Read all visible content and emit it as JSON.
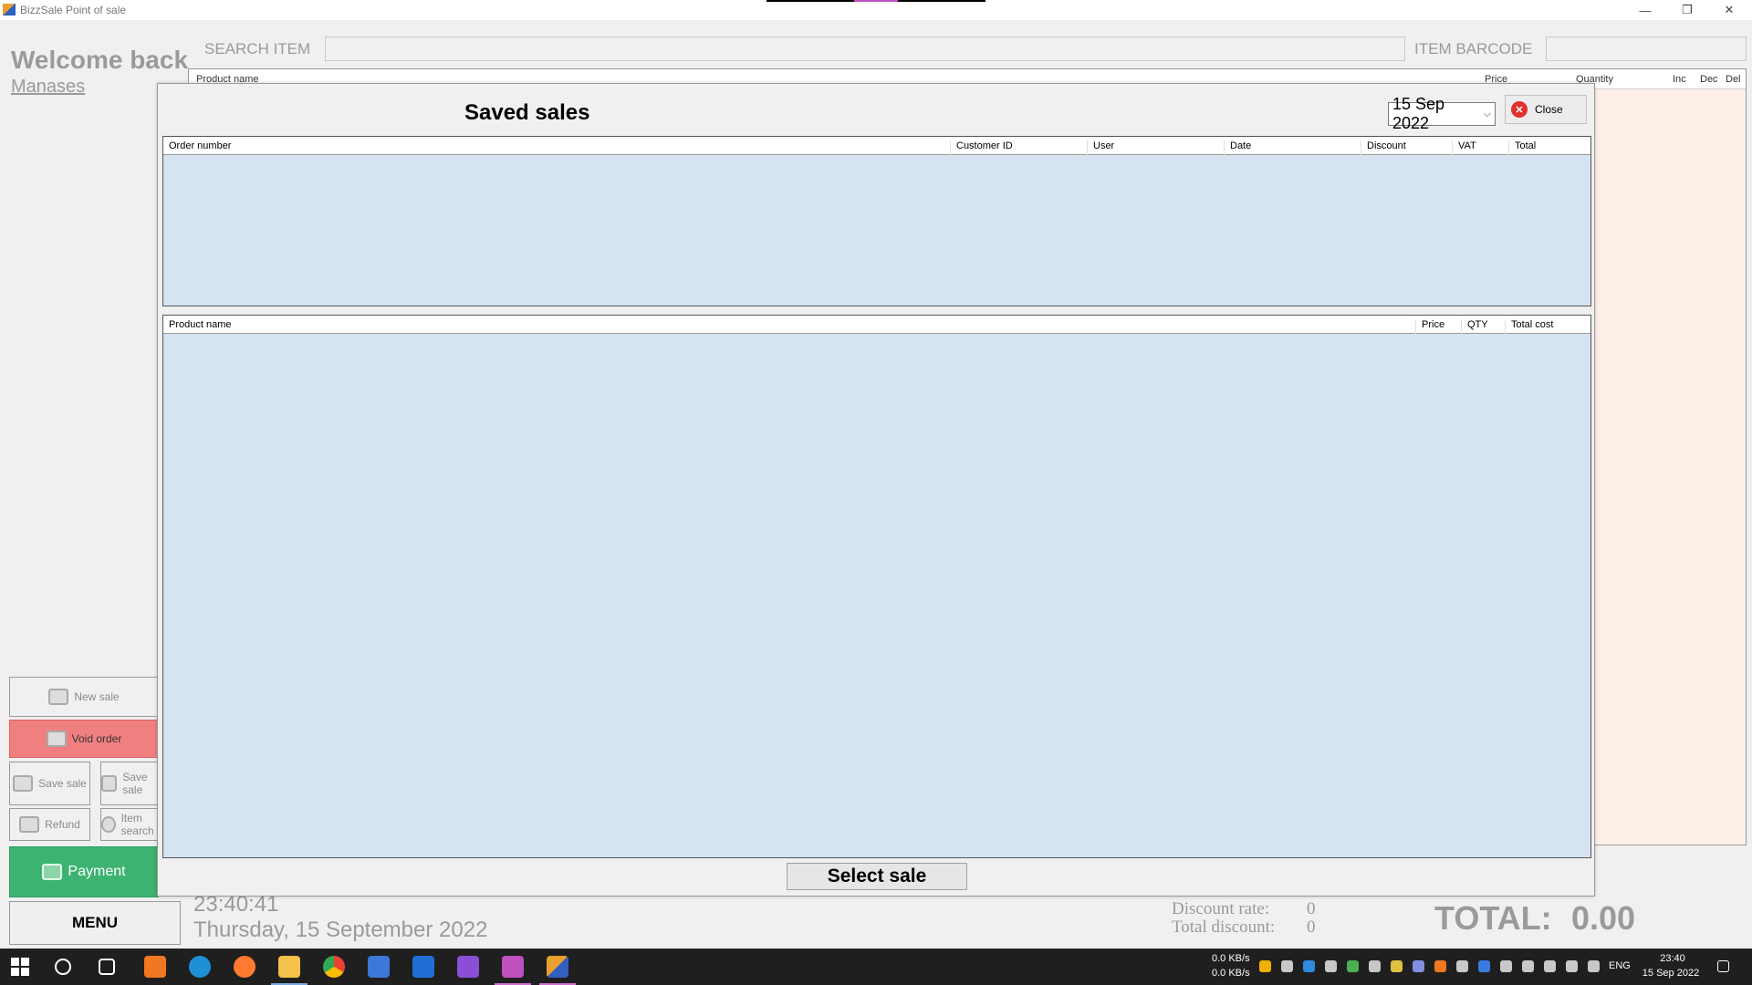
{
  "window": {
    "title": "BizzSale Point of sale",
    "minimize": "—",
    "restore": "❐",
    "close": "✕"
  },
  "main": {
    "welcome": "Welcome back",
    "user": "Manases",
    "search_label": "SEARCH ITEM",
    "barcode_label": "ITEM BARCODE",
    "cart_columns": [
      "Product name",
      "Price",
      "Quantity",
      "Inc",
      "Dec",
      "Del"
    ],
    "buttons": {
      "new_sale": "New sale",
      "void_order": "Void order",
      "save_sale": "Save sale",
      "saved_sales": "Save sale",
      "refund": "Refund",
      "item_search": "Item search",
      "payment": "Payment",
      "menu": "MENU"
    },
    "clock_time": "23:40:41",
    "clock_date": "Thursday, 15 September 2022",
    "discount_rate_label": "Discount rate:",
    "discount_rate_value": "0",
    "total_discount_label": "Total discount:",
    "total_discount_value": "0",
    "total_label": "TOTAL:",
    "total_value": "0.00"
  },
  "modal": {
    "title": "Saved sales",
    "date_value": "15 Sep 2022",
    "close_label": "Close",
    "orders_columns": [
      "Order number",
      "Customer ID",
      "User",
      "Date",
      "Discount",
      "VAT",
      "Total"
    ],
    "items_columns": [
      "Product name",
      "Price",
      "QTY",
      "Total cost"
    ],
    "select_button": "Select sale"
  },
  "taskbar": {
    "net_down": "0.0 KB/s",
    "net_up": "0.0 KB/s",
    "lang": "ENG",
    "time": "23:40",
    "date": "15 Sep 2022"
  },
  "colors": {
    "void": "#f08080",
    "payment": "#3cb371",
    "grid_bg": "#d6e4f2",
    "close_icon": "#e03030"
  }
}
